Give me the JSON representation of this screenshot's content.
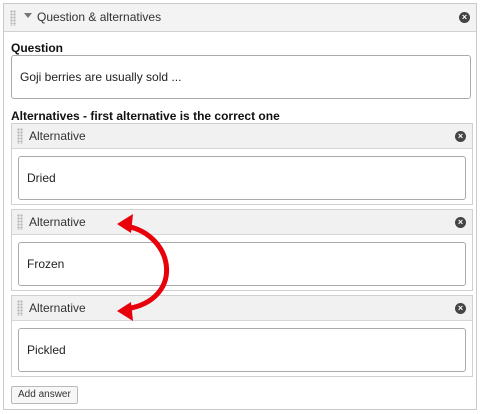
{
  "panel": {
    "title": "Question & alternatives",
    "icons": {
      "drag": "drag-handle-icon",
      "collapse": "caret-down-icon",
      "remove": "close-circle-icon"
    }
  },
  "question": {
    "label": "Question",
    "value": "Goji berries are usually sold ..."
  },
  "alternatives": {
    "label": "Alternatives - first alternative is the correct one",
    "items": [
      {
        "header": "Alternative",
        "value": "Dried"
      },
      {
        "header": "Alternative",
        "value": "Frozen"
      },
      {
        "header": "Alternative",
        "value": "Pickled"
      }
    ]
  },
  "add_button_label": "Add answer",
  "annotation": {
    "arrow_color": "#e8000b",
    "arrow": "double-headed-curved-arrow"
  }
}
